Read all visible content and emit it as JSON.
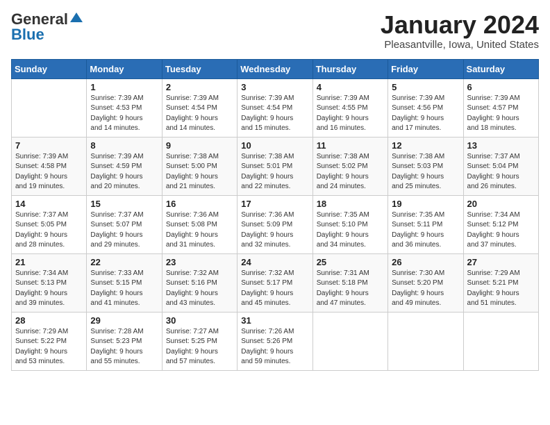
{
  "header": {
    "logo_general": "General",
    "logo_blue": "Blue",
    "title": "January 2024",
    "subtitle": "Pleasantville, Iowa, United States"
  },
  "days_of_week": [
    "Sunday",
    "Monday",
    "Tuesday",
    "Wednesday",
    "Thursday",
    "Friday",
    "Saturday"
  ],
  "weeks": [
    [
      {
        "day": "",
        "info": ""
      },
      {
        "day": "1",
        "info": "Sunrise: 7:39 AM\nSunset: 4:53 PM\nDaylight: 9 hours\nand 14 minutes."
      },
      {
        "day": "2",
        "info": "Sunrise: 7:39 AM\nSunset: 4:54 PM\nDaylight: 9 hours\nand 14 minutes."
      },
      {
        "day": "3",
        "info": "Sunrise: 7:39 AM\nSunset: 4:54 PM\nDaylight: 9 hours\nand 15 minutes."
      },
      {
        "day": "4",
        "info": "Sunrise: 7:39 AM\nSunset: 4:55 PM\nDaylight: 9 hours\nand 16 minutes."
      },
      {
        "day": "5",
        "info": "Sunrise: 7:39 AM\nSunset: 4:56 PM\nDaylight: 9 hours\nand 17 minutes."
      },
      {
        "day": "6",
        "info": "Sunrise: 7:39 AM\nSunset: 4:57 PM\nDaylight: 9 hours\nand 18 minutes."
      }
    ],
    [
      {
        "day": "7",
        "info": "Sunrise: 7:39 AM\nSunset: 4:58 PM\nDaylight: 9 hours\nand 19 minutes."
      },
      {
        "day": "8",
        "info": "Sunrise: 7:39 AM\nSunset: 4:59 PM\nDaylight: 9 hours\nand 20 minutes."
      },
      {
        "day": "9",
        "info": "Sunrise: 7:38 AM\nSunset: 5:00 PM\nDaylight: 9 hours\nand 21 minutes."
      },
      {
        "day": "10",
        "info": "Sunrise: 7:38 AM\nSunset: 5:01 PM\nDaylight: 9 hours\nand 22 minutes."
      },
      {
        "day": "11",
        "info": "Sunrise: 7:38 AM\nSunset: 5:02 PM\nDaylight: 9 hours\nand 24 minutes."
      },
      {
        "day": "12",
        "info": "Sunrise: 7:38 AM\nSunset: 5:03 PM\nDaylight: 9 hours\nand 25 minutes."
      },
      {
        "day": "13",
        "info": "Sunrise: 7:37 AM\nSunset: 5:04 PM\nDaylight: 9 hours\nand 26 minutes."
      }
    ],
    [
      {
        "day": "14",
        "info": "Sunrise: 7:37 AM\nSunset: 5:05 PM\nDaylight: 9 hours\nand 28 minutes."
      },
      {
        "day": "15",
        "info": "Sunrise: 7:37 AM\nSunset: 5:07 PM\nDaylight: 9 hours\nand 29 minutes."
      },
      {
        "day": "16",
        "info": "Sunrise: 7:36 AM\nSunset: 5:08 PM\nDaylight: 9 hours\nand 31 minutes."
      },
      {
        "day": "17",
        "info": "Sunrise: 7:36 AM\nSunset: 5:09 PM\nDaylight: 9 hours\nand 32 minutes."
      },
      {
        "day": "18",
        "info": "Sunrise: 7:35 AM\nSunset: 5:10 PM\nDaylight: 9 hours\nand 34 minutes."
      },
      {
        "day": "19",
        "info": "Sunrise: 7:35 AM\nSunset: 5:11 PM\nDaylight: 9 hours\nand 36 minutes."
      },
      {
        "day": "20",
        "info": "Sunrise: 7:34 AM\nSunset: 5:12 PM\nDaylight: 9 hours\nand 37 minutes."
      }
    ],
    [
      {
        "day": "21",
        "info": "Sunrise: 7:34 AM\nSunset: 5:13 PM\nDaylight: 9 hours\nand 39 minutes."
      },
      {
        "day": "22",
        "info": "Sunrise: 7:33 AM\nSunset: 5:15 PM\nDaylight: 9 hours\nand 41 minutes."
      },
      {
        "day": "23",
        "info": "Sunrise: 7:32 AM\nSunset: 5:16 PM\nDaylight: 9 hours\nand 43 minutes."
      },
      {
        "day": "24",
        "info": "Sunrise: 7:32 AM\nSunset: 5:17 PM\nDaylight: 9 hours\nand 45 minutes."
      },
      {
        "day": "25",
        "info": "Sunrise: 7:31 AM\nSunset: 5:18 PM\nDaylight: 9 hours\nand 47 minutes."
      },
      {
        "day": "26",
        "info": "Sunrise: 7:30 AM\nSunset: 5:20 PM\nDaylight: 9 hours\nand 49 minutes."
      },
      {
        "day": "27",
        "info": "Sunrise: 7:29 AM\nSunset: 5:21 PM\nDaylight: 9 hours\nand 51 minutes."
      }
    ],
    [
      {
        "day": "28",
        "info": "Sunrise: 7:29 AM\nSunset: 5:22 PM\nDaylight: 9 hours\nand 53 minutes."
      },
      {
        "day": "29",
        "info": "Sunrise: 7:28 AM\nSunset: 5:23 PM\nDaylight: 9 hours\nand 55 minutes."
      },
      {
        "day": "30",
        "info": "Sunrise: 7:27 AM\nSunset: 5:25 PM\nDaylight: 9 hours\nand 57 minutes."
      },
      {
        "day": "31",
        "info": "Sunrise: 7:26 AM\nSunset: 5:26 PM\nDaylight: 9 hours\nand 59 minutes."
      },
      {
        "day": "",
        "info": ""
      },
      {
        "day": "",
        "info": ""
      },
      {
        "day": "",
        "info": ""
      }
    ]
  ]
}
